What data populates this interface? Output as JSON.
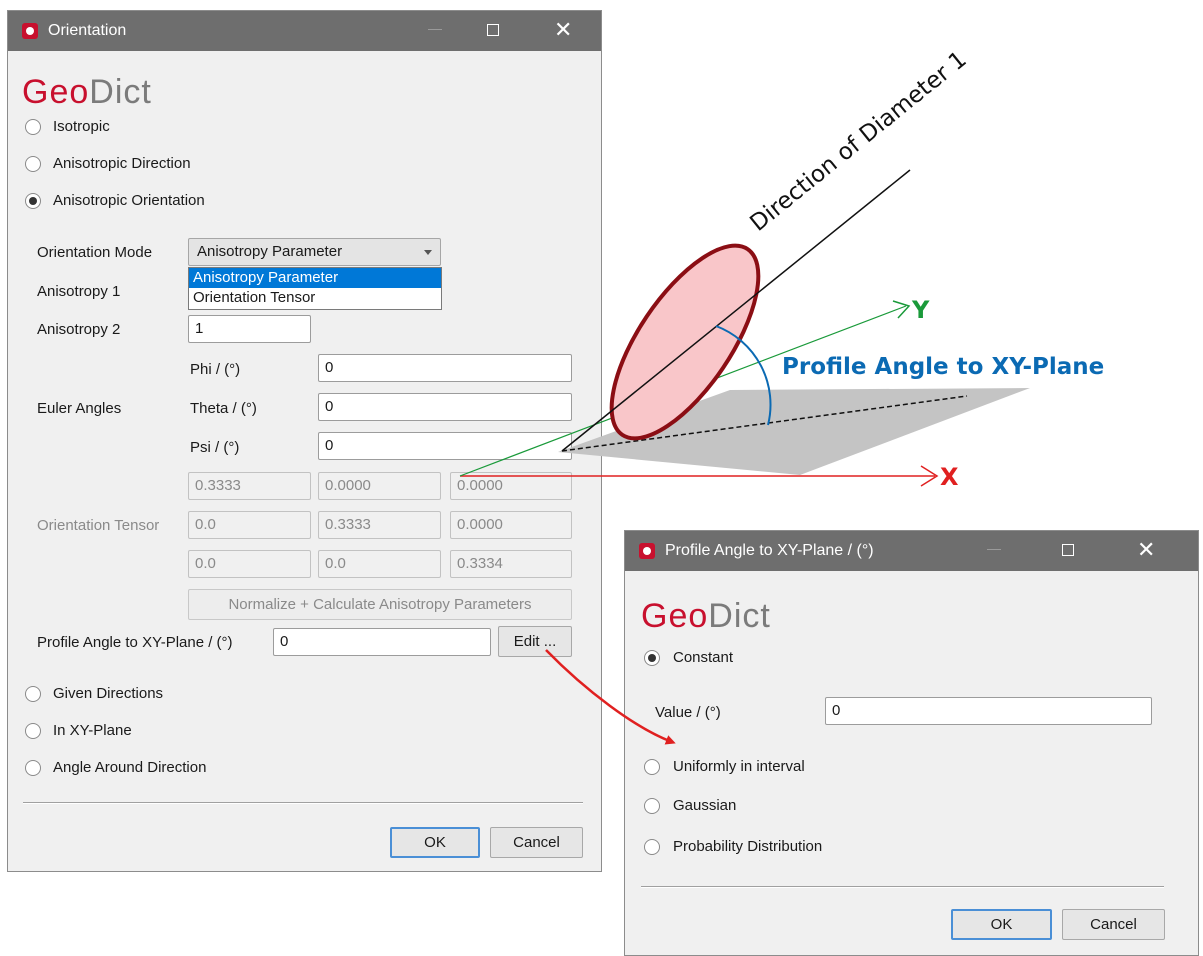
{
  "colors": {
    "brand_red": "#c8102e",
    "y_axis": "#1a9a3a",
    "x_axis": "#e02020",
    "annotation_blue": "#0b6ab3",
    "ellipse_fill": "#f9c6c9",
    "ellipse_edge": "#8b0e14",
    "plane_gray": "#c4c4c4"
  },
  "icons": {
    "app": "geodict-app-icon",
    "minimize": "minimize-icon",
    "maximize": "maximize-icon",
    "close": "close-icon"
  },
  "orientation_dialog": {
    "title": "Orientation",
    "logo": {
      "geo": "Geo",
      "dict": "Dict"
    },
    "modes": [
      "Isotropic",
      "Anisotropic Direction",
      "Anisotropic Orientation"
    ],
    "selected_mode": "Anisotropic Orientation",
    "orientation_mode": {
      "label": "Orientation Mode",
      "value": "Anisotropy Parameter",
      "options": [
        "Anisotropy Parameter",
        "Orientation Tensor"
      ]
    },
    "anisotropy1": {
      "label": "Anisotropy 1"
    },
    "anisotropy2": {
      "label": "Anisotropy 2",
      "value": "1"
    },
    "euler": {
      "label": "Euler Angles",
      "phi": {
        "label": "Phi / (°)",
        "value": "0"
      },
      "theta": {
        "label": "Theta / (°)",
        "value": "0"
      },
      "psi": {
        "label": "Psi / (°)",
        "value": "0"
      }
    },
    "tensor": {
      "label": "Orientation Tensor",
      "rows": [
        [
          "0.3333",
          "0.0000",
          "0.0000"
        ],
        [
          "0.0",
          "0.3333",
          "0.0000"
        ],
        [
          "0.0",
          "0.0",
          "0.3334"
        ]
      ]
    },
    "normalize_button": "Normalize + Calculate Anisotropy Parameters",
    "profile_angle": {
      "label": "Profile Angle to XY-Plane / (°)",
      "value": "0",
      "edit_button": "Edit ..."
    },
    "more_modes": [
      "Given Directions",
      "In XY-Plane",
      "Angle Around Direction"
    ],
    "ok": "OK",
    "cancel": "Cancel"
  },
  "profile_dialog": {
    "title": "Profile Angle to XY-Plane / (°)",
    "logo": {
      "geo": "Geo",
      "dict": "Dict"
    },
    "options": [
      "Constant",
      "Uniformly in interval",
      "Gaussian",
      "Probability Distribution"
    ],
    "selected": "Constant",
    "value": {
      "label": "Value / (°)",
      "value": "0"
    },
    "ok": "OK",
    "cancel": "Cancel"
  },
  "diagram": {
    "diameter_label": "Direction of Diameter 1",
    "angle_label": "Profile Angle to XY-Plane",
    "y_label": "Y",
    "x_label": "X"
  }
}
